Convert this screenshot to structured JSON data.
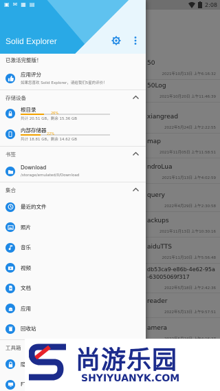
{
  "status_bar": {
    "time": "2:08"
  },
  "app": {
    "title": "Solid Explorer"
  },
  "pro_note": "已激活完整版！",
  "rate": {
    "label": "应用评分",
    "sub": "如果您喜欢 Solid Explorer，请给我们5星的评价！"
  },
  "sections": {
    "storage": "存储设备",
    "bookmarks": "书签",
    "collections": "集合",
    "tools": "工具箱"
  },
  "storage": [
    {
      "label": "根目录",
      "percent": "26%",
      "fill": 26,
      "sub": "共计 20.51 GB，剩余 15.36 GB"
    },
    {
      "label": "内部存储器",
      "percent": "22%",
      "fill": 22,
      "sub": "共计 18.81 GB，剩余 14.62 GB"
    }
  ],
  "bookmark": {
    "label": "Download",
    "sub": "/storage/emulated/0/Download"
  },
  "collections": [
    {
      "label": "最近的文件",
      "icon": "clock-icon"
    },
    {
      "label": "照片",
      "icon": "photo-icon"
    },
    {
      "label": "音乐",
      "icon": "music-icon"
    },
    {
      "label": "视频",
      "icon": "video-icon"
    },
    {
      "label": "文档",
      "icon": "document-icon"
    },
    {
      "label": "应用",
      "icon": "android-icon"
    },
    {
      "label": "回收站",
      "icon": "trash-icon"
    }
  ],
  "tools": [
    {
      "label": "隐",
      "icon": "lock-icon"
    },
    {
      "label": "FT",
      "icon": "ftp-icon"
    }
  ],
  "background_files": [
    {
      "name": "50",
      "date": "2021年10月13日 上午6:16:32"
    },
    {
      "name": "50Log",
      "date": "2021年10月20日 上午11:46:39"
    },
    {
      "name": "xiangread",
      "date": "2022年5月24日 上午2:22:55"
    },
    {
      "name": "map",
      "date": "2021年11月05日 上午11:58:51"
    },
    {
      "name": "ndroLua",
      "date": "2021年11月13日 上午4:02:59"
    },
    {
      "name": "query",
      "date": "2022年4月29日 上午2:30:58"
    },
    {
      "name": "ackups",
      "date": "2021年11月13日 上午10:30:16"
    },
    {
      "name": "aiduTTS",
      "date": "2021年11月10日 上午5:56:48"
    },
    {
      "name": "db53ca9-e86b-4e62-95a",
      "name2": "-63005069f317",
      "date": "2022年5月18日 上午2:42:36"
    },
    {
      "name": "reader",
      "date": "2022年5月13日 上午9:57:51"
    },
    {
      "name": "amera",
      "date": "2022年5月24日 上午4:16:27"
    }
  ],
  "watermark": {
    "brand_cn": "尚游乐园",
    "brand_en": "SHYIYUANYK.COM"
  },
  "colors": {
    "header": "#29a9e6",
    "accent": "#1e88e5",
    "storage_fill": "#f2a100",
    "watermark": "#1c2c8c"
  }
}
